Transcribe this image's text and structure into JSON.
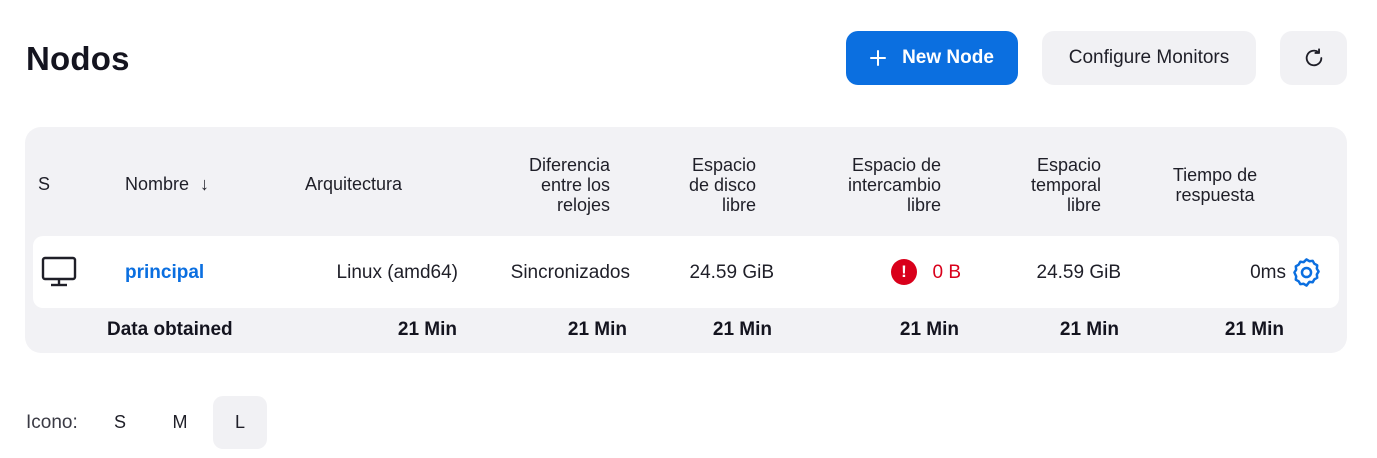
{
  "header": {
    "title": "Nodos",
    "new_node_label": "New Node",
    "configure_label": "Configure Monitors",
    "refresh_icon": "refresh-icon"
  },
  "table": {
    "headers": {
      "status": "S",
      "name": "Nombre",
      "name_sort": "↓",
      "arch": "Arquitectura",
      "clock_lines": [
        "Diferencia",
        "entre los",
        "relojes"
      ],
      "disk_lines": [
        "Espacio",
        "de disco",
        "libre"
      ],
      "swap_lines": [
        "Espacio de",
        "intercambio",
        "libre"
      ],
      "temp_lines": [
        "Espacio",
        "temporal",
        "libre"
      ],
      "response_lines": [
        "Tiempo de",
        "respuesta"
      ]
    },
    "rows": [
      {
        "icon": "computer-icon",
        "name": "principal",
        "arch": "Linux (amd64)",
        "clock": "Sincronizados",
        "disk": "24.59 GiB",
        "swap": "0 B",
        "swap_status": "error",
        "temp": "24.59 GiB",
        "response": "0ms",
        "settings_icon": "gear-icon"
      }
    ],
    "footer": {
      "label": "Data obtained",
      "arch": "21 Min",
      "clock": "21 Min",
      "disk": "21 Min",
      "swap": "21 Min",
      "temp": "21 Min",
      "response": "21 Min"
    }
  },
  "icon_size": {
    "label": "Icono:",
    "options": [
      "S",
      "M",
      "L"
    ],
    "selected": "L"
  },
  "colors": {
    "accent": "#0b6fe0",
    "danger": "#d9001b",
    "panel": "#f2f2f5"
  }
}
